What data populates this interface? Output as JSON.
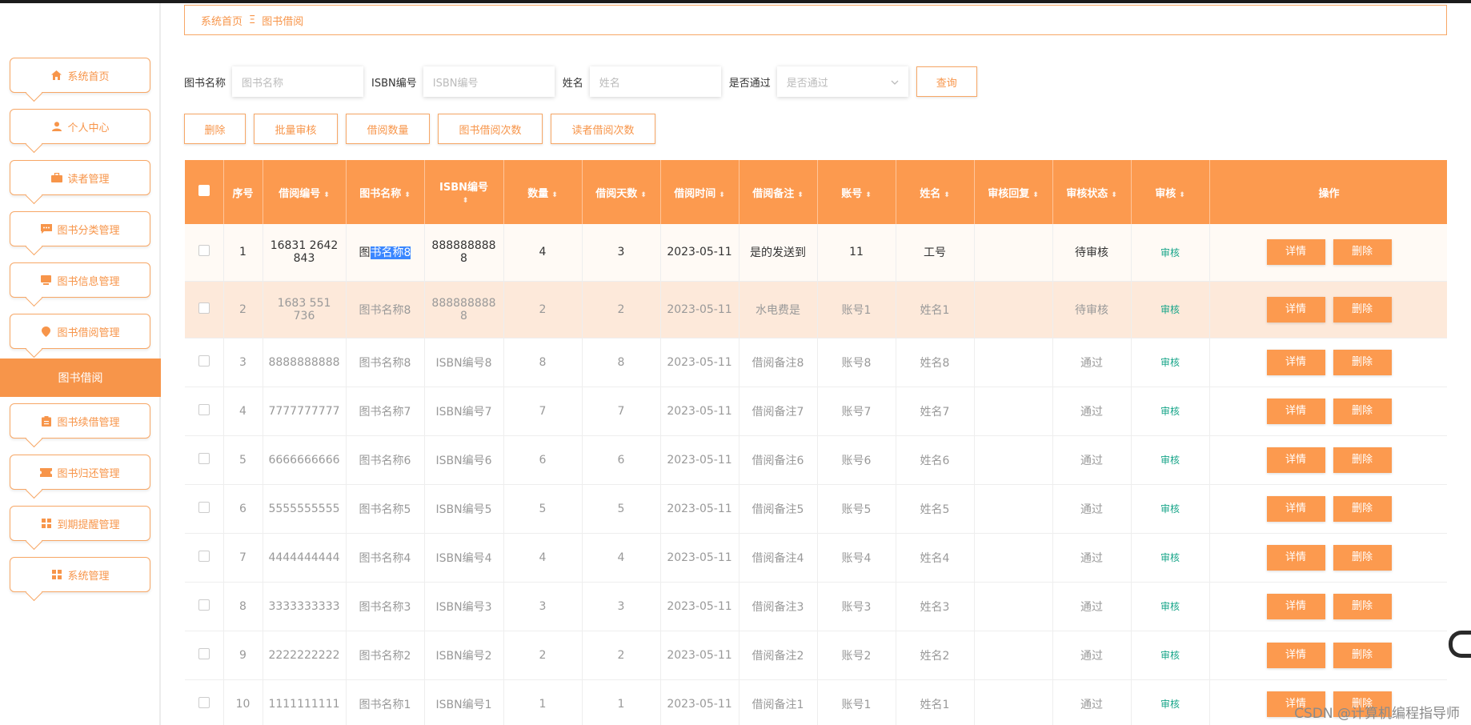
{
  "breadcrumb": {
    "home": "系统首页",
    "current": "图书借阅"
  },
  "sidebar": {
    "items": [
      {
        "label": "系统首页",
        "icon": "home-icon"
      },
      {
        "label": "个人中心",
        "icon": "user-icon"
      },
      {
        "label": "读者管理",
        "icon": "briefcase-icon"
      },
      {
        "label": "图书分类管理",
        "icon": "chat-icon"
      },
      {
        "label": "图书信息管理",
        "icon": "monitor-icon"
      },
      {
        "label": "图书借阅管理",
        "icon": "location-icon"
      }
    ],
    "active": "图书借阅",
    "items_after": [
      {
        "label": "图书续借管理",
        "icon": "clipboard-icon"
      },
      {
        "label": "图书归还管理",
        "icon": "ticket-icon"
      },
      {
        "label": "到期提醒管理",
        "icon": "grid-icon"
      },
      {
        "label": "系统管理",
        "icon": "grid-icon"
      }
    ]
  },
  "search": {
    "book_name_label": "图书名称",
    "book_name_placeholder": "图书名称",
    "isbn_label": "ISBN编号",
    "isbn_placeholder": "ISBN编号",
    "name_label": "姓名",
    "name_placeholder": "姓名",
    "pass_label": "是否通过",
    "pass_placeholder": "是否通过",
    "query_button": "查询"
  },
  "actions": {
    "delete": "删除",
    "batch_audit": "批量审核",
    "borrow_count": "借阅数量",
    "book_borrow_times": "图书借阅次数",
    "reader_borrow_times": "读者借阅次数"
  },
  "table": {
    "headers": [
      "序号",
      "借阅编号",
      "图书名称",
      "ISBN编号",
      "数量",
      "借阅天数",
      "借阅时间",
      "借阅备注",
      "账号",
      "姓名",
      "审核回复",
      "审核状态",
      "审核",
      "操作"
    ],
    "detail_label": "详情",
    "delete_label": "删除",
    "audit_label": "审核",
    "rows": [
      {
        "no": "1",
        "code": "16831 2642\n843",
        "book": "图书名称8",
        "isbn": "888888888\n8",
        "qty": "4",
        "days": "3",
        "time": "2023-05-11",
        "note": "是的发送到",
        "account": "11",
        "name": "工号",
        "reply": "",
        "status": "待审核"
      },
      {
        "no": "2",
        "code": "1683 551\n736",
        "book": "图书名称8",
        "isbn": "888888888\n8",
        "qty": "2",
        "days": "2",
        "time": "2023-05-11",
        "note": "水电费是",
        "account": "账号1",
        "name": "姓名1",
        "reply": "",
        "status": "待审核"
      },
      {
        "no": "3",
        "code": "8888888888",
        "book": "图书名称8",
        "isbn": "ISBN编号8",
        "qty": "8",
        "days": "8",
        "time": "2023-05-11",
        "note": "借阅备注8",
        "account": "账号8",
        "name": "姓名8",
        "reply": "",
        "status": "通过"
      },
      {
        "no": "4",
        "code": "7777777777",
        "book": "图书名称7",
        "isbn": "ISBN编号7",
        "qty": "7",
        "days": "7",
        "time": "2023-05-11",
        "note": "借阅备注7",
        "account": "账号7",
        "name": "姓名7",
        "reply": "",
        "status": "通过"
      },
      {
        "no": "5",
        "code": "6666666666",
        "book": "图书名称6",
        "isbn": "ISBN编号6",
        "qty": "6",
        "days": "6",
        "time": "2023-05-11",
        "note": "借阅备注6",
        "account": "账号6",
        "name": "姓名6",
        "reply": "",
        "status": "通过"
      },
      {
        "no": "6",
        "code": "5555555555",
        "book": "图书名称5",
        "isbn": "ISBN编号5",
        "qty": "5",
        "days": "5",
        "time": "2023-05-11",
        "note": "借阅备注5",
        "account": "账号5",
        "name": "姓名5",
        "reply": "",
        "status": "通过"
      },
      {
        "no": "7",
        "code": "4444444444",
        "book": "图书名称4",
        "isbn": "ISBN编号4",
        "qty": "4",
        "days": "4",
        "time": "2023-05-11",
        "note": "借阅备注4",
        "account": "账号4",
        "name": "姓名4",
        "reply": "",
        "status": "通过"
      },
      {
        "no": "8",
        "code": "3333333333",
        "book": "图书名称3",
        "isbn": "ISBN编号3",
        "qty": "3",
        "days": "3",
        "time": "2023-05-11",
        "note": "借阅备注3",
        "account": "账号3",
        "name": "姓名3",
        "reply": "",
        "status": "通过"
      },
      {
        "no": "9",
        "code": "2222222222",
        "book": "图书名称2",
        "isbn": "ISBN编号2",
        "qty": "2",
        "days": "2",
        "time": "2023-05-11",
        "note": "借阅备注2",
        "account": "账号2",
        "name": "姓名2",
        "reply": "",
        "status": "通过"
      },
      {
        "no": "10",
        "code": "1111111111",
        "book": "图书名称1",
        "isbn": "ISBN编号1",
        "qty": "1",
        "days": "1",
        "time": "2023-05-11",
        "note": "借阅备注1",
        "account": "账号1",
        "name": "姓名1",
        "reply": "",
        "status": "通过"
      }
    ]
  },
  "watermark": "CSDN @计算机编程指导师",
  "colors": {
    "accent": "#fc9a4f",
    "border": "#f7a766",
    "audit_link": "#17a589",
    "selected_row": "#fde9da"
  }
}
